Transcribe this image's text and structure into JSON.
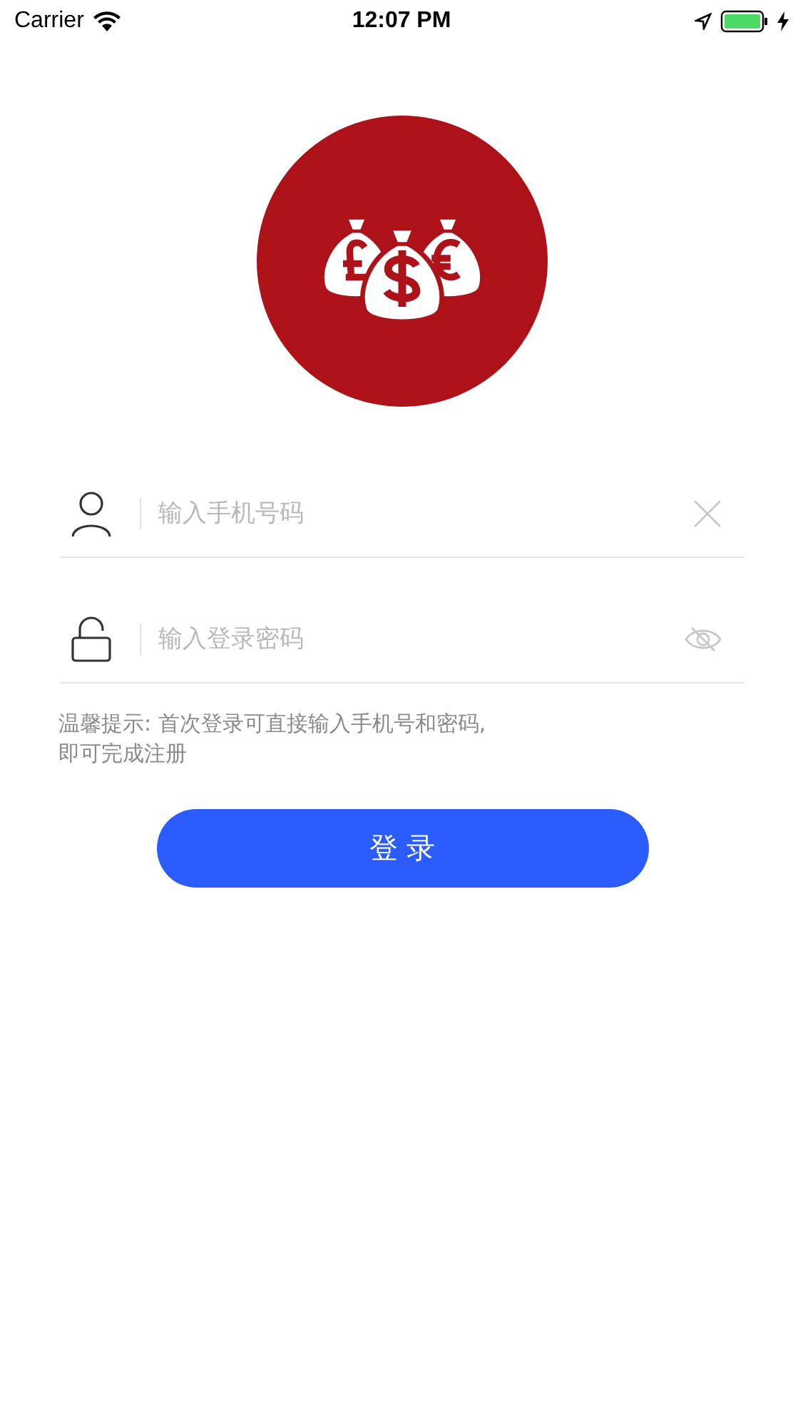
{
  "status_bar": {
    "carrier": "Carrier",
    "time": "12:07 PM"
  },
  "fields": [
    {
      "kind": "phone",
      "placeholder": "输入手机号码"
    },
    {
      "kind": "password",
      "placeholder": "输入登录密码"
    }
  ],
  "hint": "温馨提示: 首次登录可直接输入手机号和密码,\n即可完成注册",
  "login_button": "登 录"
}
